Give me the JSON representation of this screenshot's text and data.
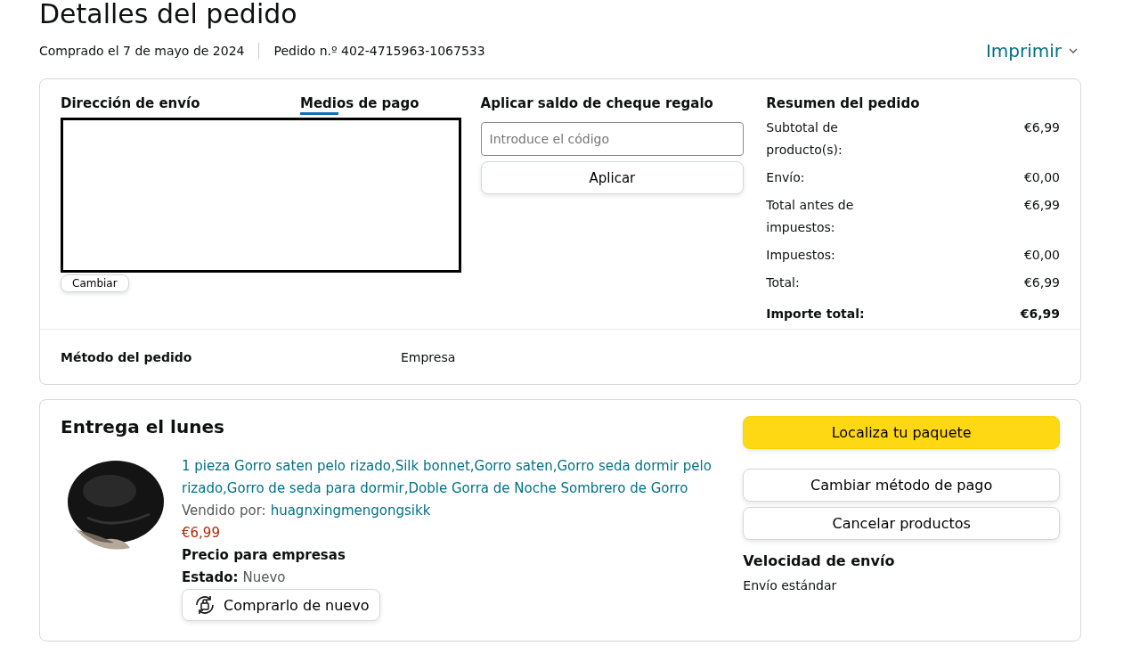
{
  "title": "Detalles del pedido",
  "purchase_date": "Comprado el 7 de mayo de 2024",
  "order_number": "Pedido n.º 402-4715963-1067533",
  "print_menu": "Imprimir",
  "shipping": {
    "heading": "Dirección de envío",
    "redacted": true,
    "change_button": "Cambiar"
  },
  "payment": {
    "heading": "Medios de pago",
    "selected": true
  },
  "gift_card": {
    "heading": "Aplicar saldo de cheque regalo",
    "placeholder": "Introduce el código",
    "button": "Aplicar"
  },
  "summary": {
    "heading": "Resumen del pedido",
    "rows": [
      {
        "label": "Subtotal de producto(s):",
        "value": "€6,99",
        "bold": false
      },
      {
        "label": "Envío:",
        "value": "€0,00",
        "bold": false
      },
      {
        "label": "Total antes de impuestos:",
        "value": "€6,99",
        "bold": false
      },
      {
        "label": "Impuestos:",
        "value": "€0,00",
        "bold": false
      },
      {
        "label": "Total:",
        "value": "€6,99",
        "bold": false
      },
      {
        "label": "Importe total:",
        "value": "€6,99",
        "bold": true
      }
    ]
  },
  "order_method": {
    "label": "Método del pedido",
    "value": "Empresa"
  },
  "delivery": {
    "heading": "Entrega el lunes",
    "item": {
      "kind": "picture",
      "title": "1 pieza Gorro saten pelo rizado,Silk bonnet,Gorro saten,Gorro seda dormir pelo rizado,Gorro de seda para dormir,Doble Gorra de Noche Sombrero de Gorro",
      "sold_by_label": "Vendido por:",
      "seller": "huagnxingmengongsikk",
      "price": "€6,99",
      "business_price": "Precio para empresas",
      "condition_label": "Estado:",
      "condition": "Nuevo",
      "buy_again": "Comprarlo de nuevo"
    },
    "actions": [
      {
        "label": "Localiza tu paquete",
        "primary": true
      },
      {
        "label": "Cambiar método de pago",
        "primary": false
      },
      {
        "label": "Cancelar productos",
        "primary": false
      }
    ],
    "speed_heading": "Velocidad de envío",
    "speed": "Envío estándar"
  }
}
